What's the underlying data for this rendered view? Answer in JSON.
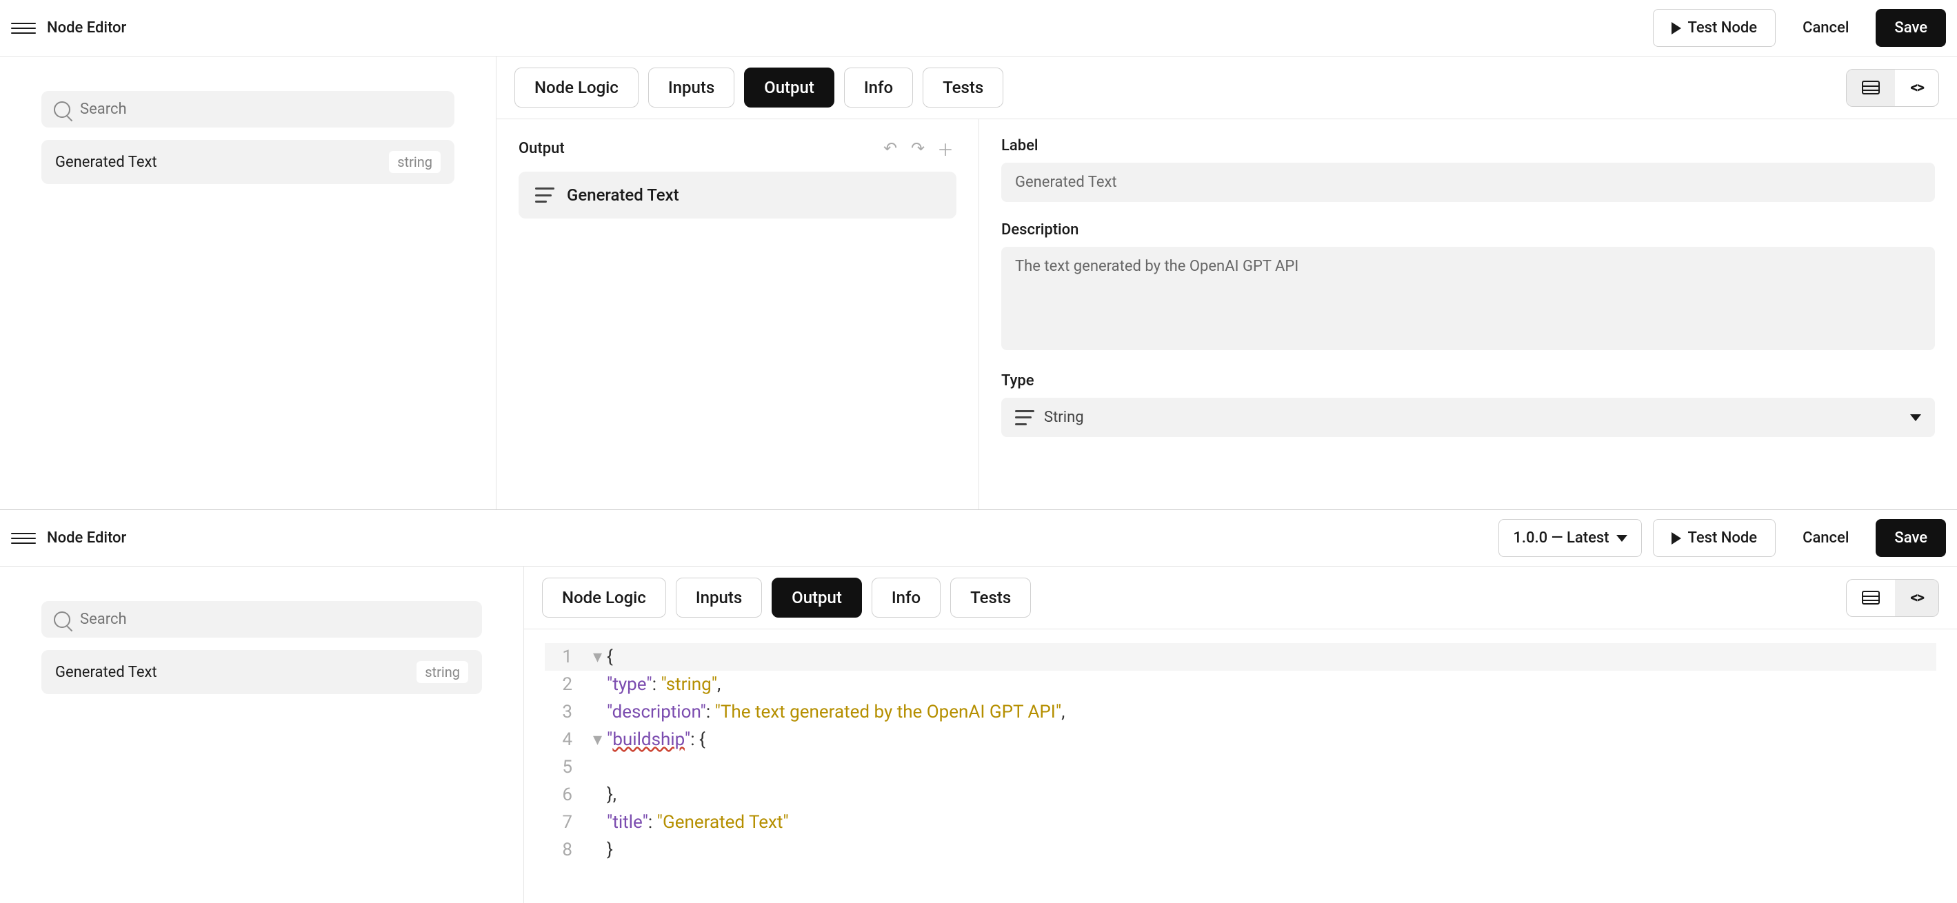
{
  "top": {
    "header": {
      "title": "Node Editor",
      "test_node": "Test Node",
      "cancel": "Cancel",
      "save": "Save"
    },
    "sidebar": {
      "search_placeholder": "Search",
      "item": {
        "name": "Generated Text",
        "type": "string"
      }
    },
    "tabs": {
      "node_logic": "Node Logic",
      "inputs": "Inputs",
      "output": "Output",
      "info": "Info",
      "tests": "Tests",
      "active": "output"
    },
    "view_mode": "form",
    "output_column": {
      "title": "Output",
      "card": "Generated Text"
    },
    "form": {
      "label_label": "Label",
      "label_value": "Generated Text",
      "description_label": "Description",
      "description_value": "The text generated by the OpenAI GPT API",
      "type_label": "Type",
      "type_value": "String"
    }
  },
  "bottom": {
    "header": {
      "title": "Node Editor",
      "version": "1.0.0 — Latest",
      "test_node": "Test Node",
      "cancel": "Cancel",
      "save": "Save"
    },
    "sidebar": {
      "search_placeholder": "Search",
      "item": {
        "name": "Generated Text",
        "type": "string"
      }
    },
    "tabs": {
      "node_logic": "Node Logic",
      "inputs": "Inputs",
      "output": "Output",
      "info": "Info",
      "tests": "Tests",
      "active": "output"
    },
    "view_mode": "code",
    "code": {
      "lines": [
        {
          "n": 1,
          "fold": true,
          "seg": [
            {
              "t": "punc",
              "v": "{"
            }
          ]
        },
        {
          "n": 2,
          "indent": 1,
          "seg": [
            {
              "t": "key",
              "v": "\"type\""
            },
            {
              "t": "punc",
              "v": ": "
            },
            {
              "t": "str",
              "v": "\"string\""
            },
            {
              "t": "punc",
              "v": ","
            }
          ]
        },
        {
          "n": 3,
          "indent": 1,
          "seg": [
            {
              "t": "key",
              "v": "\"description\""
            },
            {
              "t": "punc",
              "v": ": "
            },
            {
              "t": "str",
              "v": "\"The text generated by the OpenAI GPT API\""
            },
            {
              "t": "punc",
              "v": ","
            }
          ]
        },
        {
          "n": 4,
          "fold": true,
          "indent": 1,
          "seg": [
            {
              "t": "key",
              "v": "\""
            },
            {
              "t": "keyu",
              "v": "buildship"
            },
            {
              "t": "key",
              "v": "\""
            },
            {
              "t": "punc",
              "v": ": {"
            }
          ]
        },
        {
          "n": 5,
          "indent": 1,
          "seg": []
        },
        {
          "n": 6,
          "indent": 1,
          "seg": [
            {
              "t": "punc",
              "v": "},"
            }
          ]
        },
        {
          "n": 7,
          "indent": 1,
          "seg": [
            {
              "t": "key",
              "v": "\"title\""
            },
            {
              "t": "punc",
              "v": ": "
            },
            {
              "t": "str",
              "v": "\"Generated Text\""
            }
          ]
        },
        {
          "n": 8,
          "seg": [
            {
              "t": "punc",
              "v": "}"
            }
          ]
        }
      ]
    }
  }
}
